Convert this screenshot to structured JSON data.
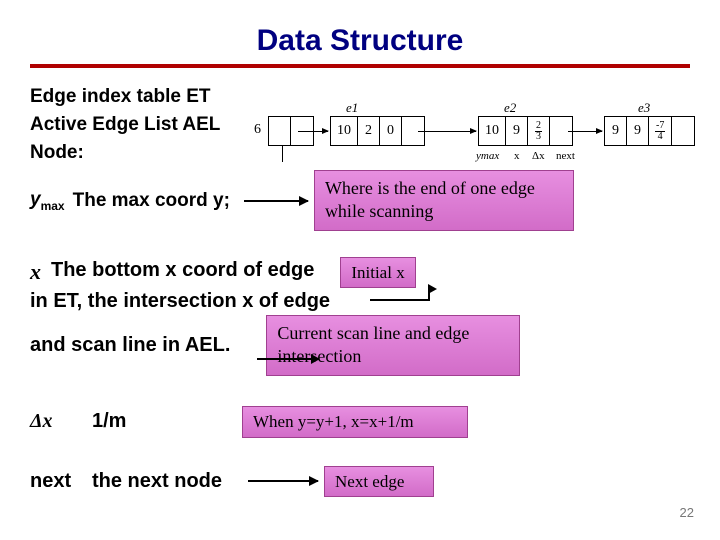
{
  "title": "Data Structure",
  "left": {
    "l1": "Edge index table ET",
    "l2": "Active Edge List AEL",
    "l3": "Node:",
    "ymax_var": "y",
    "ymax_sub": "max",
    "ymax_desc": "The max coord y;"
  },
  "callouts": {
    "where": "Where is the end of one edge while scanning",
    "initial": "Initial x",
    "current": "Current scan line and edge intersection",
    "when": "When y=y+1, x=x+1/m",
    "nextedge": "Next edge"
  },
  "xblock": {
    "x": "x",
    "l1": "The bottom x coord of edge",
    "l2": "in ET, the intersection x of edge",
    "l3": "and scan line in AEL."
  },
  "dx": {
    "label": "Δx",
    "value": "1/m"
  },
  "next": {
    "label": "next",
    "value": "the next node"
  },
  "diagram": {
    "head6": "6",
    "e1": "e1",
    "e2": "e2",
    "e3": "e3",
    "b1": {
      "c1": "10",
      "c2": "2",
      "c3": "0"
    },
    "b2": {
      "c1": "10",
      "c2": "9",
      "f2n": "2",
      "f2d": "3"
    },
    "b3": {
      "c1": "9",
      "c2": "9",
      "f3n": "-7",
      "f3d": "4"
    },
    "leg_ymax": "ymax",
    "leg_x": "x",
    "leg_dx": "Δx",
    "leg_next": "next"
  },
  "slide": "22"
}
